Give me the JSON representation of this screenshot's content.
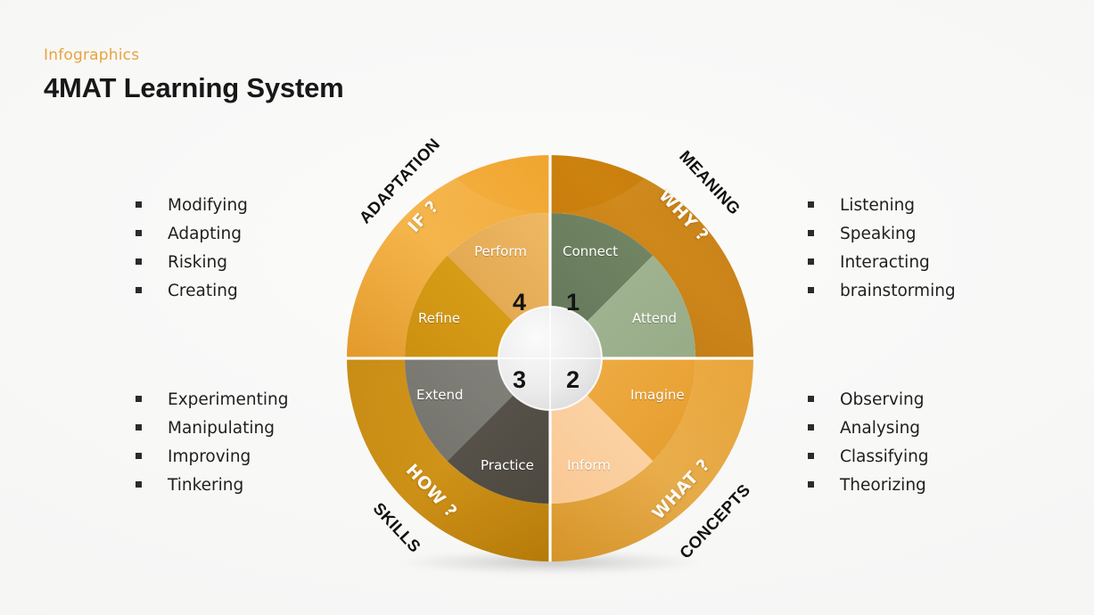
{
  "header": {
    "kicker": "Infographics",
    "title": "4MAT Learning System"
  },
  "lists": {
    "top_left": [
      "Modifying",
      "Adapting",
      "Risking",
      "Creating"
    ],
    "bottom_left": [
      "Experimenting",
      "Manipulating",
      "Improving",
      "Tinkering"
    ],
    "top_right": [
      "Listening",
      "Speaking",
      "Interacting",
      "brainstorming"
    ],
    "bottom_right": [
      "Observing",
      "Analysing",
      "Classifying",
      "Theorizing"
    ]
  },
  "wheel": {
    "center_numbers": {
      "top_left": "4",
      "top_right": "1",
      "bottom_left": "3",
      "bottom_right": "2"
    },
    "segments": {
      "perform": "Perform",
      "refine": "Refine",
      "connect": "Connect",
      "attend": "Attend",
      "extend": "Extend",
      "practice": "Practice",
      "imagine": "Imagine",
      "inform": "Inform"
    },
    "ring_questions": {
      "if": "IF ?",
      "why": "WHY ?",
      "how": "HOW ?",
      "what": "WHAT ?"
    },
    "outer_labels": {
      "adaptation": "ADAPTATION",
      "meaning": "MEANING",
      "skills": "SKILLS",
      "concepts": "CONCEPTS"
    }
  },
  "colors": {
    "accent": "#e8a33d",
    "ring_top_left": "#f2ab33",
    "ring_top_right": "#c87d0c",
    "ring_bottom_left": "#d08e0d",
    "ring_bottom_right": "#f3ae3c",
    "seg_perform": "#e8b05a",
    "seg_refine": "#d79a14",
    "seg_connect": "#6c8060",
    "seg_attend": "#9db18d",
    "seg_extend": "#7b7b74",
    "seg_practice": "#534f46",
    "seg_imagine": "#e9a43a",
    "seg_inform": "#fbcf9f",
    "inner_disc": "#e9e9ea",
    "background": "#f6f6f5"
  }
}
